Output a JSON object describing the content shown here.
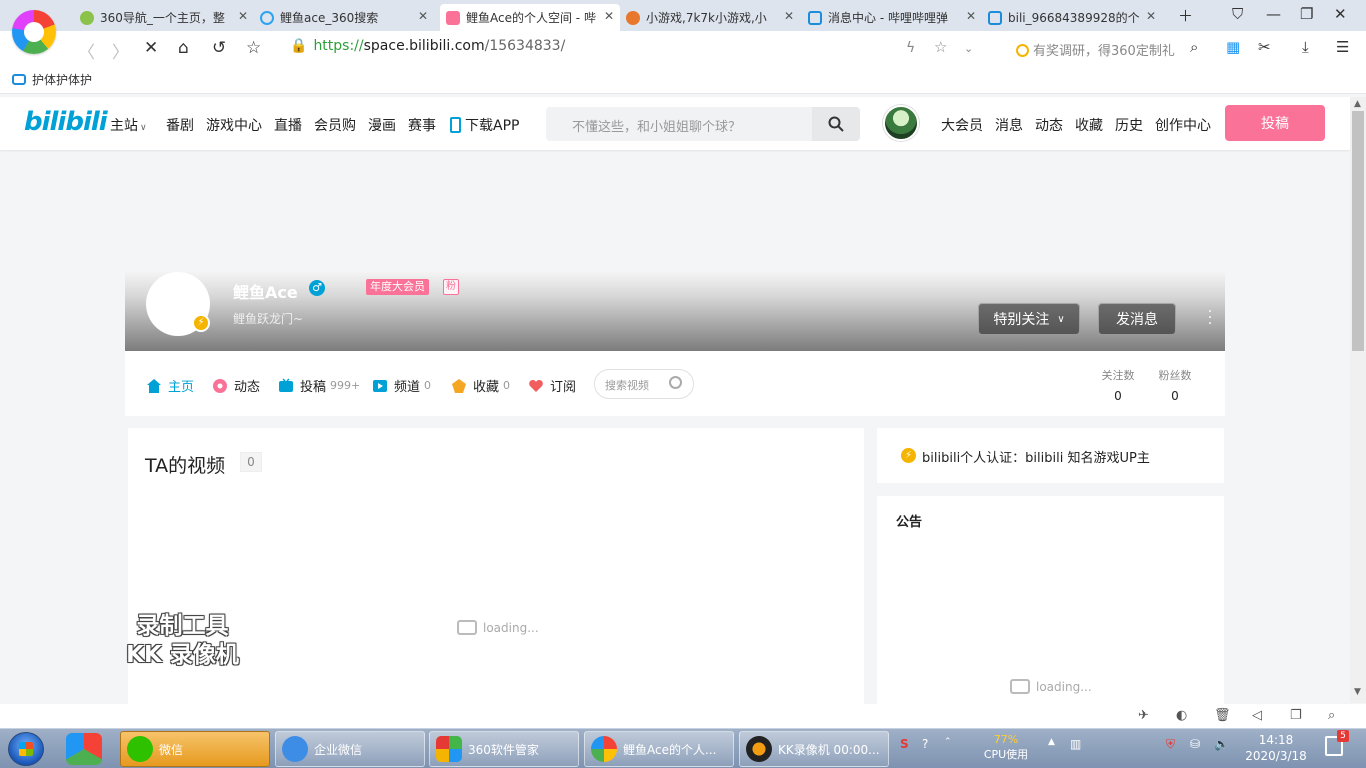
{
  "browser": {
    "tabs": [
      {
        "label": "360导航_一个主页，整",
        "icon_color": "#8bc34a"
      },
      {
        "label": "鲤鱼ace_360搜索",
        "icon_color": "#2ea3f2"
      },
      {
        "label": "鲤鱼Ace的个人空间 - 哔",
        "icon_color": "#fb7299"
      },
      {
        "label": "小游戏,7k7k小游戏,小",
        "icon_color": "#e8772e"
      },
      {
        "label": "消息中心 - 哔哩哔哩弹",
        "icon_color": "#1c8ddb"
      },
      {
        "label": "bili_96684389928的个",
        "icon_color": "#1c8ddb"
      }
    ],
    "url": {
      "scheme": "https://",
      "host": "space.bilibili.com",
      "path": "/15634833/"
    },
    "search_hint": "有奖调研，得360定制礼",
    "favorites": [
      {
        "label": "护体护体护"
      }
    ]
  },
  "site": {
    "logo": "bilibili",
    "nav": {
      "main": "主站",
      "items": [
        "番剧",
        "游戏中心",
        "直播",
        "会员购",
        "漫画",
        "赛事"
      ],
      "download": "下载APP"
    },
    "search_placeholder": "不懂这些，和小姐姐聊个球？",
    "right_nav": [
      "大会员",
      "消息",
      "动态",
      "收藏",
      "历史",
      "创作中心"
    ],
    "upload_label": "投稿"
  },
  "profile": {
    "name": "鲤鱼Ace",
    "gender_symbol": "♂",
    "vip_label": "年度大会员",
    "fan_label": "粉",
    "sign": "鲤鱼跃龙门~",
    "follow_label": "特别关注",
    "message_label": "发消息"
  },
  "profile_tabs": {
    "items": [
      {
        "label": "主页",
        "count": "",
        "icon_color": "#00a1d6"
      },
      {
        "label": "动态",
        "count": "",
        "icon_color": "#fb7299"
      },
      {
        "label": "投稿",
        "count": "999+",
        "icon_color": "#00a1d6"
      },
      {
        "label": "频道",
        "count": "0",
        "icon_color": "#00a1d6"
      },
      {
        "label": "收藏",
        "count": "0",
        "icon_color": "#f5a623"
      },
      {
        "label": "订阅",
        "count": "",
        "icon_color": "#f25d5d"
      }
    ],
    "search_placeholder": "搜索视频",
    "stats": [
      {
        "label": "关注数",
        "value": "0"
      },
      {
        "label": "粉丝数",
        "value": "0"
      }
    ]
  },
  "videos": {
    "title": "TA的视频",
    "count": "0",
    "loading": "loading..."
  },
  "certification": "bilibili个人认证：bilibili 知名游戏UP主",
  "notice": {
    "title": "公告",
    "loading": "loading..."
  },
  "watermark": {
    "line1": "录制工具",
    "line2": "KK 录像机"
  },
  "taskbar": {
    "apps": [
      {
        "label": "微信",
        "icon_color": "#2dc100"
      },
      {
        "label": "企业微信",
        "icon_color": "#3d8de6"
      },
      {
        "label": "360软件管家",
        "icon_color": "#43b649"
      },
      {
        "label": "鲤鱼Ace的个人...",
        "icon_color": "#e53935"
      },
      {
        "label": "KK录像机 00:00...",
        "icon_color": "#222222"
      }
    ],
    "cpu_percent": "77%",
    "cpu_label": "CPU使用",
    "time": "14:18",
    "date": "2020/3/18",
    "notification_count": "5"
  },
  "colors": {
    "accent": "#00a1d6",
    "pink": "#fb7299"
  }
}
